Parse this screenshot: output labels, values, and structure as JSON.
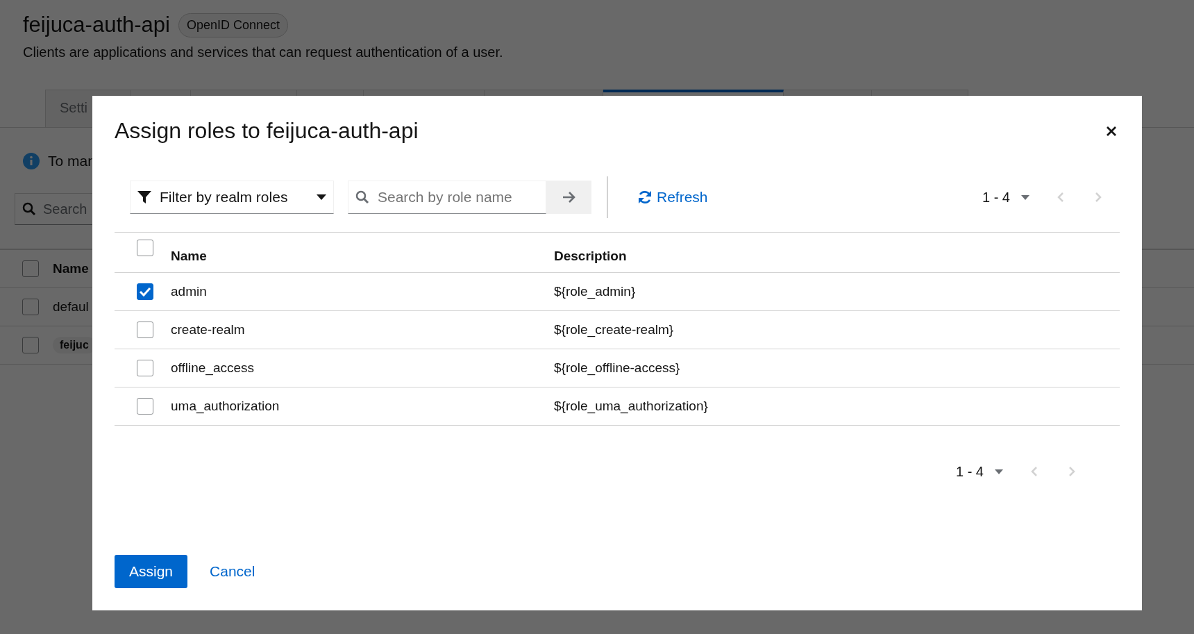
{
  "page": {
    "title": "feijuca-auth-api",
    "protocol_badge": "OpenID Connect",
    "subtitle": "Clients are applications and services that can request authentication of a user.",
    "tabs": [
      {
        "label": "Setti",
        "selected": false
      },
      {
        "selected": false
      },
      {
        "selected": false
      },
      {
        "selected": false
      },
      {
        "selected": false
      },
      {
        "selected": false
      },
      {
        "selected": true
      },
      {
        "selected": false
      },
      {
        "selected": false
      }
    ],
    "info": "To man",
    "search": {
      "placeholder": "Search"
    },
    "table": {
      "header": {
        "label": "Name",
        "checked": false
      },
      "rows": [
        {
          "kind": "text",
          "name": "defaul",
          "checked": false
        },
        {
          "kind": "chip",
          "name": "feijuc",
          "checked": false
        }
      ]
    }
  },
  "modal": {
    "title": "Assign roles to feijuca-auth-api",
    "filter": "Filter by realm roles",
    "search": {
      "placeholder": "Search by role name"
    },
    "refresh": "Refresh",
    "pagination_top": "1 - 4",
    "pagination_bottom": "1 - 4",
    "columns": [
      "Name",
      "Description"
    ],
    "select_all": false,
    "rows": [
      {
        "name": "admin",
        "description": "${role_admin}",
        "selected": true
      },
      {
        "name": "create-realm",
        "description": "${role_create-realm}",
        "selected": false
      },
      {
        "name": "offline_access",
        "description": "${role_offline-access}",
        "selected": false
      },
      {
        "name": "uma_authorization",
        "description": "${role_uma_authorization}",
        "selected": false
      }
    ],
    "buttons": {
      "primary": "Assign",
      "secondary": "Cancel"
    }
  }
}
